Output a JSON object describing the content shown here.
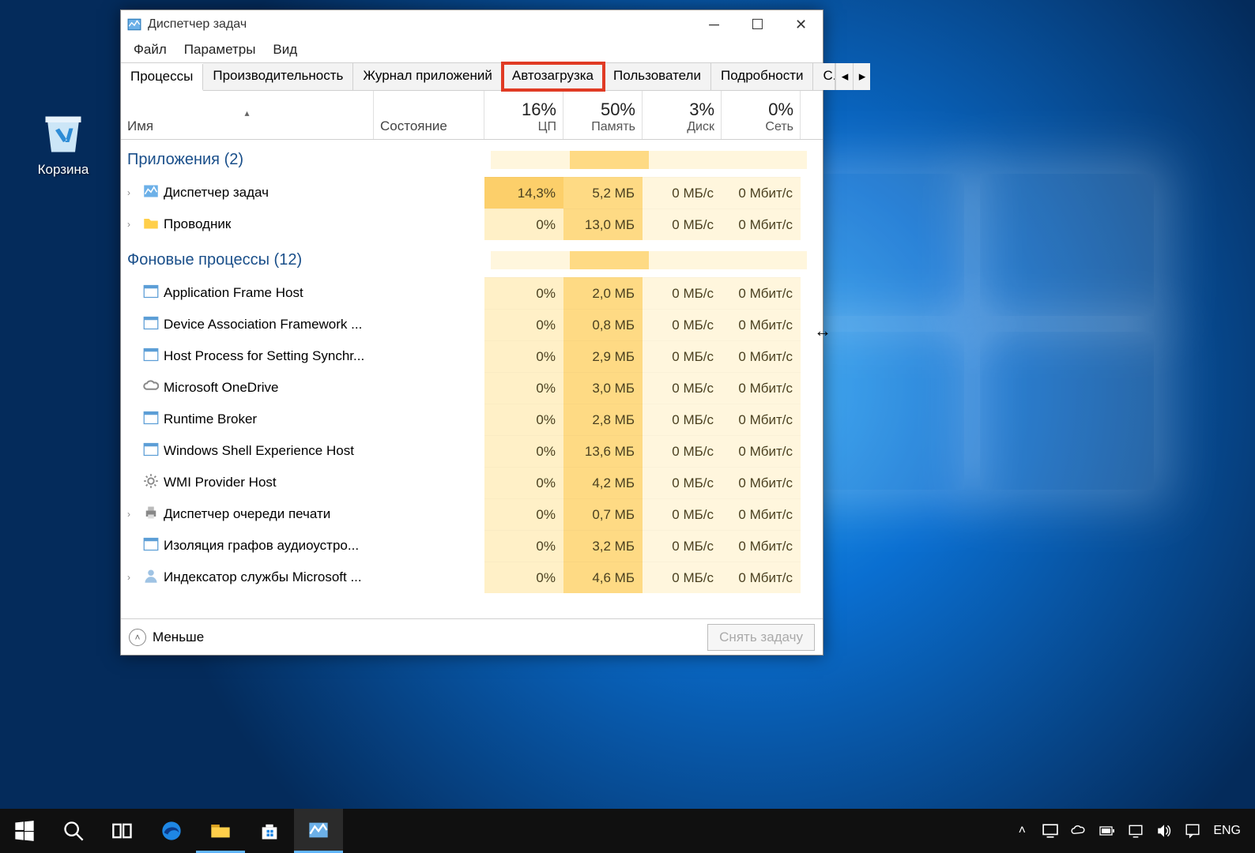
{
  "desktop": {
    "recycle_bin_label": "Корзина"
  },
  "window": {
    "title": "Диспетчер задач",
    "menu": {
      "file": "Файл",
      "options": "Параметры",
      "view": "Вид"
    },
    "tabs": {
      "processes": "Процессы",
      "performance": "Производительность",
      "app_history": "Журнал приложений",
      "startup": "Автозагрузка",
      "users": "Пользователи",
      "details": "Подробности",
      "services_trunc": "С..."
    },
    "columns": {
      "name": "Имя",
      "status": "Состояние",
      "cpu_pct": "16%",
      "cpu_lbl": "ЦП",
      "mem_pct": "50%",
      "mem_lbl": "Память",
      "disk_pct": "3%",
      "disk_lbl": "Диск",
      "net_pct": "0%",
      "net_lbl": "Сеть"
    },
    "groups": {
      "apps": "Приложения (2)",
      "bg": "Фоновые процессы (12)"
    },
    "rows": [
      {
        "exp": true,
        "icon": "tm",
        "name": "Диспетчер задач",
        "cpu": "14,3%",
        "mem": "5,2 МБ",
        "disk": "0 МБ/с",
        "net": "0 Мбит/с",
        "hot": true
      },
      {
        "exp": true,
        "icon": "folder",
        "name": "Проводник",
        "cpu": "0%",
        "mem": "13,0 МБ",
        "disk": "0 МБ/с",
        "net": "0 Мбит/с"
      },
      {
        "exp": false,
        "icon": "exe",
        "name": "Application Frame Host",
        "cpu": "0%",
        "mem": "2,0 МБ",
        "disk": "0 МБ/с",
        "net": "0 Мбит/с"
      },
      {
        "exp": false,
        "icon": "exe",
        "name": "Device Association Framework ...",
        "cpu": "0%",
        "mem": "0,8 МБ",
        "disk": "0 МБ/с",
        "net": "0 Мбит/с"
      },
      {
        "exp": false,
        "icon": "exe",
        "name": "Host Process for Setting Synchr...",
        "cpu": "0%",
        "mem": "2,9 МБ",
        "disk": "0 МБ/с",
        "net": "0 Мбит/с"
      },
      {
        "exp": false,
        "icon": "cloud",
        "name": "Microsoft OneDrive",
        "cpu": "0%",
        "mem": "3,0 МБ",
        "disk": "0 МБ/с",
        "net": "0 Мбит/с"
      },
      {
        "exp": false,
        "icon": "exe",
        "name": "Runtime Broker",
        "cpu": "0%",
        "mem": "2,8 МБ",
        "disk": "0 МБ/с",
        "net": "0 Мбит/с"
      },
      {
        "exp": false,
        "icon": "exe",
        "name": "Windows Shell Experience Host",
        "cpu": "0%",
        "mem": "13,6 МБ",
        "disk": "0 МБ/с",
        "net": "0 Мбит/с"
      },
      {
        "exp": false,
        "icon": "gear",
        "name": "WMI Provider Host",
        "cpu": "0%",
        "mem": "4,2 МБ",
        "disk": "0 МБ/с",
        "net": "0 Мбит/с"
      },
      {
        "exp": true,
        "icon": "print",
        "name": "Диспетчер очереди печати",
        "cpu": "0%",
        "mem": "0,7 МБ",
        "disk": "0 МБ/с",
        "net": "0 Мбит/с"
      },
      {
        "exp": false,
        "icon": "exe",
        "name": "Изоляция графов аудиоустро...",
        "cpu": "0%",
        "mem": "3,2 МБ",
        "disk": "0 МБ/с",
        "net": "0 Мбит/с"
      },
      {
        "exp": true,
        "icon": "user",
        "name": "Индексатор службы Microsoft ...",
        "cpu": "0%",
        "mem": "4,6 МБ",
        "disk": "0 МБ/с",
        "net": "0 Мбит/с"
      }
    ],
    "footer": {
      "less": "Меньше",
      "end_task": "Снять задачу"
    }
  },
  "taskbar": {
    "lang": "ENG"
  }
}
